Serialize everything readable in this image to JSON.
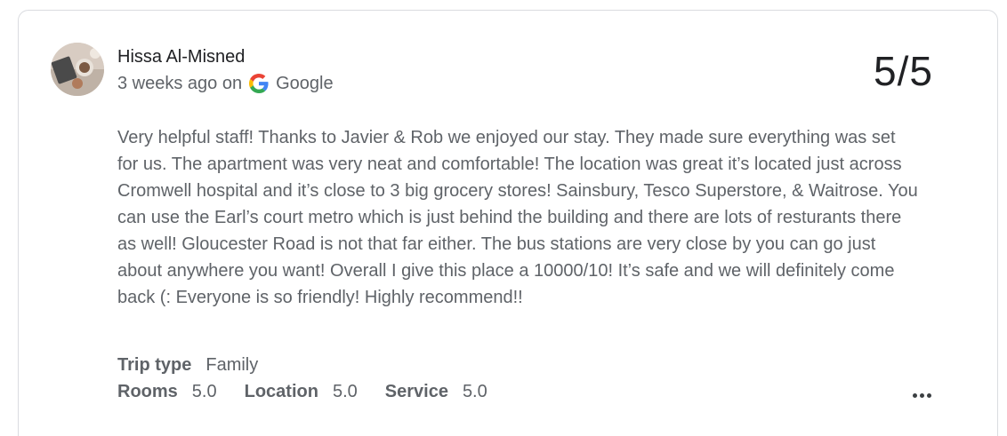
{
  "review": {
    "reviewer_name": "Hissa Al-Misned",
    "time_ago": "3 weeks ago on",
    "source": "Google",
    "score": "5/5",
    "text": "Very helpful staff! Thanks to Javier & Rob we enjoyed our stay. They made sure everything was set for us. The apartment was very neat and comfortable! The location was great it’s located just across Cromwell hospital and it’s close to 3 big grocery stores! Sainsbury, Tesco Superstore, & Waitrose. You can use the Earl’s court metro which is just behind the building and there are lots of resturants there as well! Gloucester Road is not that far either. The bus stations are very close by you can go just about anywhere you want! Overall I give this place a 10000/10! It’s safe and we will definitely come back (: Everyone is so friendly! Highly recommend!!",
    "trip_type_label": "Trip type",
    "trip_type_value": "Family",
    "ratings": [
      {
        "label": "Rooms",
        "value": "5.0"
      },
      {
        "label": "Location",
        "value": "5.0"
      },
      {
        "label": "Service",
        "value": "5.0"
      }
    ],
    "icons": {
      "avatar": "avatar-photo",
      "source_icon": "google-icon",
      "more": "more-options-icon"
    }
  }
}
